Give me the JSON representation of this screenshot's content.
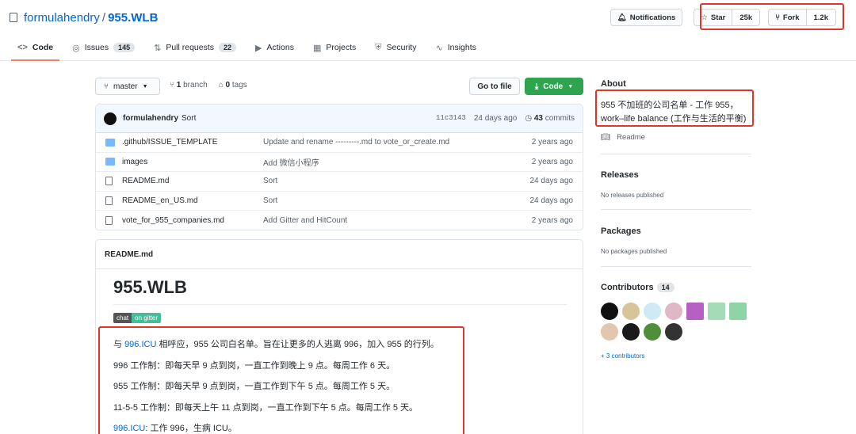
{
  "repo": {
    "owner": "formulahendry",
    "separator": "/",
    "name": "955.WLB"
  },
  "actions": {
    "notifications": "Notifications",
    "star": {
      "label": "Star",
      "count": "25k"
    },
    "fork": {
      "label": "Fork",
      "count": "1.2k"
    }
  },
  "tabs": [
    {
      "icon": "<>",
      "label": "Code"
    },
    {
      "icon": "◎",
      "label": "Issues",
      "count": "145"
    },
    {
      "icon": "⇅",
      "label": "Pull requests",
      "count": "22"
    },
    {
      "icon": "▶",
      "label": "Actions"
    },
    {
      "icon": "▦",
      "label": "Projects"
    },
    {
      "icon": "⛨",
      "label": "Security"
    },
    {
      "icon": "∿",
      "label": "Insights"
    }
  ],
  "branch": {
    "name": "master",
    "branches_count": "1",
    "branches_label": "branch",
    "tags_count": "0",
    "tags_label": "tags"
  },
  "buttons": {
    "goto_file": "Go to file",
    "code": "Code"
  },
  "latest_commit": {
    "author": "formulahendry",
    "message": "Sort",
    "sha": "11c3143",
    "when": "24 days ago",
    "commits_count": "43",
    "commits_label": "commits"
  },
  "files": [
    {
      "type": "folder",
      "name": ".github/ISSUE_TEMPLATE",
      "message": "Update and rename ---------.md to vote_or_create.md",
      "date": "2 years ago"
    },
    {
      "type": "folder",
      "name": "images",
      "message": "Add 微信小程序",
      "date": "2 years ago"
    },
    {
      "type": "file",
      "name": "README.md",
      "message": "Sort",
      "date": "24 days ago"
    },
    {
      "type": "file",
      "name": "README_en_US.md",
      "message": "Sort",
      "date": "24 days ago"
    },
    {
      "type": "file",
      "name": "vote_for_955_companies.md",
      "message": "Add Gitter and HitCount",
      "date": "2 years ago"
    }
  ],
  "readme": {
    "header": "README.md",
    "title": "955.WLB",
    "gitter_left": "chat",
    "gitter_right": "on gitter",
    "paragraphs": [
      {
        "prefix": "与 ",
        "link": "996.ICU",
        "rest": " 相呼应，955 公司白名单。旨在让更多的人逃离 996，加入 955 的行列。"
      },
      {
        "prefix": "",
        "link": "",
        "rest": "996 工作制：即每天早 9 点到岗，一直工作到晚上 9 点。每周工作 6 天。"
      },
      {
        "prefix": "",
        "link": "",
        "rest": "955 工作制：即每天早 9 点到岗，一直工作到下午 5 点。每周工作 5 天。"
      },
      {
        "prefix": "",
        "link": "",
        "rest": "11-5-5 工作制：即每天上午 11 点到岗，一直工作到下午 5 点。每周工作 5 天。"
      },
      {
        "prefix": "",
        "link": "996.ICU",
        "rest": ": 工作 996，生病 ICU。"
      }
    ]
  },
  "sidebar": {
    "about_title": "About",
    "about_desc": "955 不加班的公司名单 - 工作 955，work–life balance (工作与生活的平衡)",
    "readme_link": "Readme",
    "releases_title": "Releases",
    "releases_text": "No releases published",
    "packages_title": "Packages",
    "packages_text": "No packages published",
    "contributors_title": "Contributors",
    "contributors_count": "14",
    "more_contributors": "+ 3 contributors"
  },
  "colors": {
    "accent": "#0366d6",
    "highlight": "#e0352b",
    "green": "#2ea44f"
  }
}
